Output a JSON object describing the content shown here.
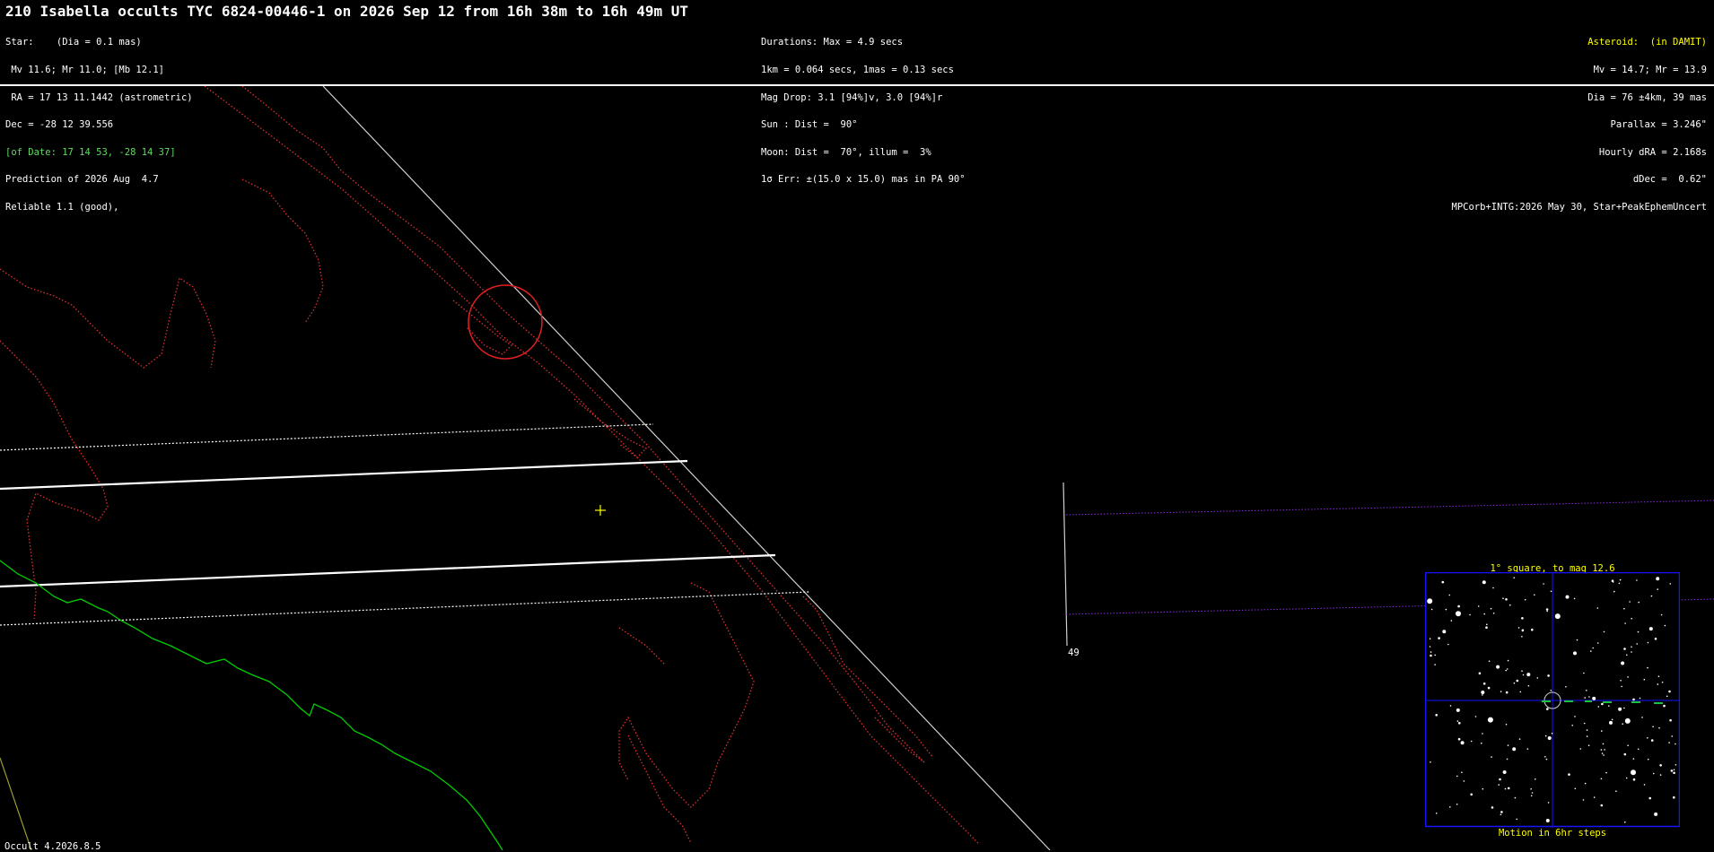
{
  "header": {
    "title": "210 Isabella occults TYC 6824-00446-1 on 2026 Sep 12 from 16h 38m to 16h 49m UT",
    "left_lines": [
      "Star:    (Dia = 0.1 mas)",
      " Mv 11.6; Mr 11.0; [Mb 12.1]",
      " RA = 17 13 11.1442 (astrometric)",
      "Dec = -28 12 39.556",
      "[of Date: 17 14 53, -28 14 37]",
      "Prediction of 2026 Aug  4.7",
      "Reliable 1.1 (good),"
    ],
    "mid_lines": [
      "Durations: Max = 4.9 secs",
      "1km = 0.064 secs, 1mas = 0.13 secs",
      "Mag Drop: 3.1 [94%]v, 3.0 [94%]r",
      "Sun : Dist =  90°",
      "Moon: Dist =  70°, illum =  3%",
      "1σ Err: ±(15.0 x 15.0) mas in PA 90°"
    ],
    "right_lines": [
      "Asteroid:  (in DAMIT)",
      "Mv = 14.7; Mr = 13.9",
      "Dia = 76 ±4km, 39 mas",
      "Parallax = 3.246\"",
      "Hourly dRA = 2.168s",
      "dDec =  0.62\"",
      "MPCorb+INTG:2026 May 30, Star+PeakEphemUncert"
    ]
  },
  "map": {
    "path_line_color": "#ffffff",
    "coast_color": "#e03030",
    "green_line_color": "#00cc00",
    "purple_line_color": "#8a2be2",
    "center_marker_color": "#ffff00",
    "tick_label": "49"
  },
  "inset": {
    "title": "1° square, to mag 12.6",
    "footer": "Motion in 6hr steps",
    "border_color": "#0000ff"
  },
  "footer": {
    "version": "Occult 4.2026.8.5"
  }
}
